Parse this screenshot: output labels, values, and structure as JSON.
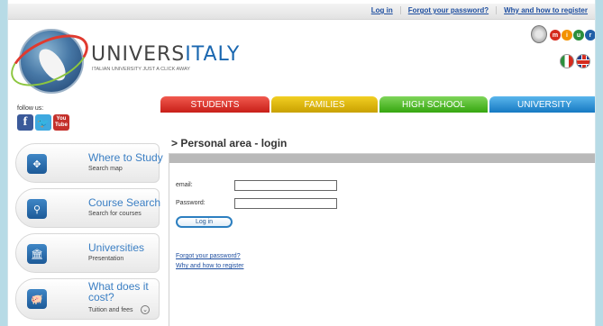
{
  "topbar": {
    "login": "Log in",
    "forgot": "Forgot your password?",
    "why": "Why and how to register"
  },
  "logo": {
    "brand_part1": "UNIVERS",
    "brand_part2": "ITALY",
    "tagline": "ITALIAN UNIVERSITY JUST A CLICK AWAY"
  },
  "partners": {
    "miur_letters": [
      "m",
      "i",
      "u",
      "r"
    ]
  },
  "social": {
    "label": "follow us:",
    "facebook": "f",
    "youtube_top": "You",
    "youtube_bottom": "Tube"
  },
  "tabs": [
    {
      "label": "STUDENTS"
    },
    {
      "label": "FAMILIES"
    },
    {
      "label": "HIGH SCHOOL"
    },
    {
      "label": "UNIVERSITY"
    }
  ],
  "page": {
    "title": "> Personal area - login"
  },
  "sidebar": {
    "items": [
      {
        "title": "Where to Study",
        "subtitle": "Search map"
      },
      {
        "title": "Course Search",
        "subtitle": "Search for courses"
      },
      {
        "title": "Universities",
        "subtitle": "Presentation"
      },
      {
        "title_line1": "What does it",
        "title_line2": "cost?",
        "subtitle": "Tuition and fees"
      }
    ]
  },
  "form": {
    "email_label": "email:",
    "email_value": "",
    "password_label": "Password:",
    "password_value": "",
    "login_button": "Log in",
    "forgot_link": "Forgot your password?",
    "register_link": "Why and how to register"
  },
  "colors": {
    "background": "#b7dbe6",
    "students": "#d9261c",
    "families": "#d8b200",
    "highschool": "#4cb320",
    "university": "#1f87cf",
    "link": "#1f4fa0"
  }
}
